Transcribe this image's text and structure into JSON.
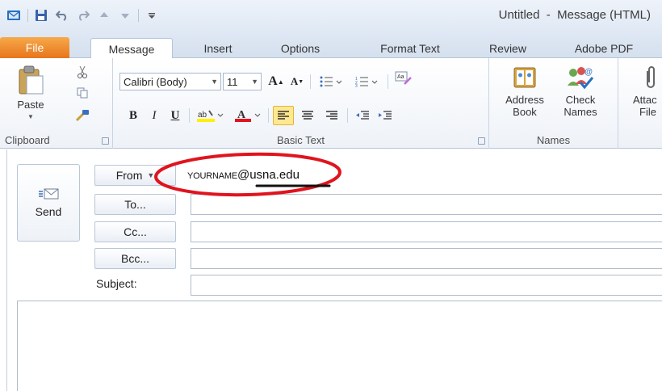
{
  "window": {
    "title": "Untitled  -  Message (HTML)"
  },
  "quick_access": [
    "outlook-icon",
    "save-icon",
    "undo-icon",
    "redo-icon",
    "up-arrow-icon",
    "down-arrow-icon",
    "customize-icon"
  ],
  "tabs": {
    "file": "File",
    "items": [
      "Message",
      "Insert",
      "Options",
      "Format Text",
      "Review",
      "Adobe PDF"
    ],
    "active": "Message"
  },
  "ribbon": {
    "clipboard": {
      "label": "Clipboard",
      "paste": "Paste"
    },
    "basic_text": {
      "label": "Basic Text",
      "font_name": "Calibri (Body)",
      "font_size": "11",
      "bold": "B",
      "italic": "I",
      "underline": "U"
    },
    "names": {
      "label": "Names",
      "address_book": [
        "Address",
        "Book"
      ],
      "check_names": [
        "Check",
        "Names"
      ]
    },
    "include": {
      "attach_file": [
        "Attac",
        "File"
      ]
    }
  },
  "compose": {
    "send": "Send",
    "from_button": "From",
    "to_button": "To...",
    "cc_button": "Cc...",
    "bcc_button": "Bcc...",
    "subject_label": "Subject:",
    "from_address": {
      "name": "YOURNAME",
      "domain": "@usna.edu"
    },
    "to_value": "",
    "cc_value": "",
    "bcc_value": "",
    "subject_value": ""
  },
  "colors": {
    "file_tab": "#e8751b",
    "annotation_ellipse": "#e0141e",
    "highlight_button": "#ffe98f"
  }
}
